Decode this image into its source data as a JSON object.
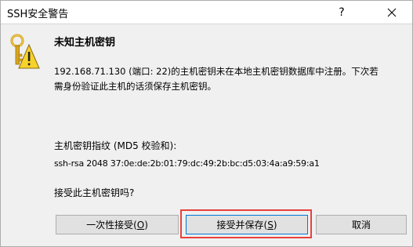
{
  "window": {
    "title": "SSH安全警告",
    "help_glyph": "?",
    "close_glyph": "close"
  },
  "content": {
    "heading": "未知主机密钥",
    "message": "192.168.71.130 (端口: 22)的主机密钥未在本地主机密钥数据库中注册。下次若需身份验证此主机的话须保存主机密钥。",
    "fingerprint_label": "主机密钥指纹 (MD5 校验和):",
    "fingerprint_value": "ssh-rsa 2048 37:0e:de:2b:01:79:dc:49:2b:bc:d5:03:4a:a9:59:a1",
    "question": "接受此主机密钥吗?"
  },
  "buttons": {
    "accept_once": {
      "label": "一次性接受(",
      "key": "O",
      "suffix": ")"
    },
    "accept_save": {
      "label": "接受并保存(",
      "key": "S",
      "suffix": ")"
    },
    "cancel": {
      "label": "取消"
    }
  },
  "colors": {
    "highlight": "#e8413d",
    "focus_border": "#0078d7",
    "dialog_bg": "#f0f0f0"
  },
  "icons": {
    "main": "key-warning-icon",
    "close": "close-icon"
  }
}
